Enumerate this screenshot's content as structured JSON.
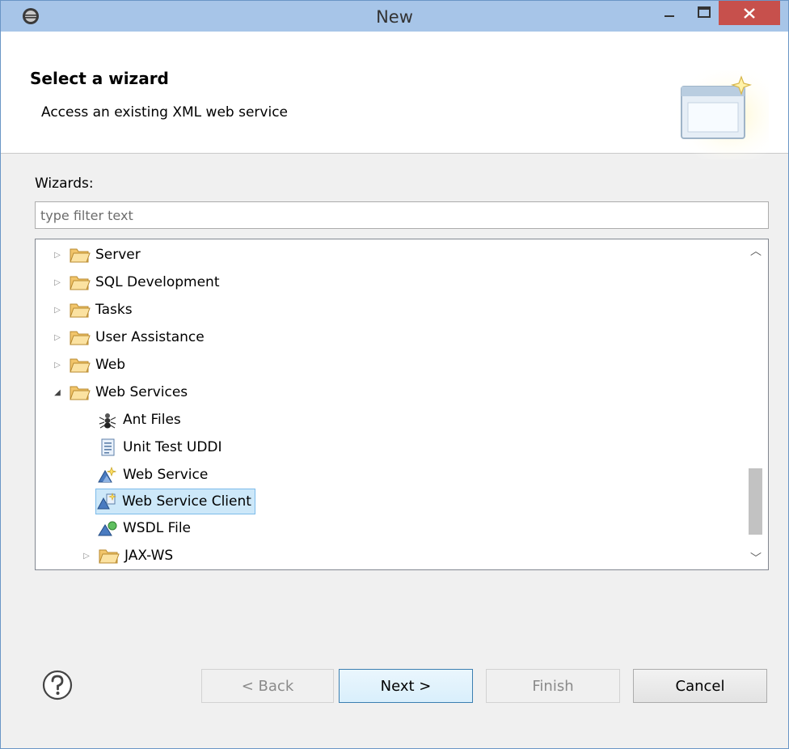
{
  "window": {
    "title": "New"
  },
  "header": {
    "title": "Select a wizard",
    "description": "Access an existing XML web service"
  },
  "wizards_label": "Wizards:",
  "filter": {
    "placeholder": "type filter text",
    "value": ""
  },
  "tree": {
    "items": [
      {
        "label": "Server",
        "icon": "folder-icon",
        "state": "collapsed"
      },
      {
        "label": "SQL Development",
        "icon": "folder-icon",
        "state": "collapsed"
      },
      {
        "label": "Tasks",
        "icon": "folder-icon",
        "state": "collapsed"
      },
      {
        "label": "User Assistance",
        "icon": "folder-icon",
        "state": "collapsed"
      },
      {
        "label": "Web",
        "icon": "folder-icon",
        "state": "collapsed"
      },
      {
        "label": "Web Services",
        "icon": "folder-icon",
        "state": "expanded"
      },
      {
        "label": "Ant Files",
        "icon": "ant-icon"
      },
      {
        "label": "Unit Test UDDI",
        "icon": "test-document-icon"
      },
      {
        "label": "Web Service",
        "icon": "web-service-icon"
      },
      {
        "label": "Web Service Client",
        "icon": "web-service-client-icon",
        "selected": true
      },
      {
        "label": "WSDL File",
        "icon": "wsdl-file-icon"
      },
      {
        "label": "JAX-WS",
        "icon": "folder-icon",
        "state": "collapsed"
      }
    ],
    "selected_label": "Web Service Client"
  },
  "buttons": {
    "back": "< Back",
    "next": "Next >",
    "finish": "Finish",
    "cancel": "Cancel"
  },
  "colors": {
    "titlebar": "#a7c5e8",
    "close_button": "#c7504c",
    "selection": "#cde8f9",
    "default_button_border": "#3c7fb1"
  }
}
